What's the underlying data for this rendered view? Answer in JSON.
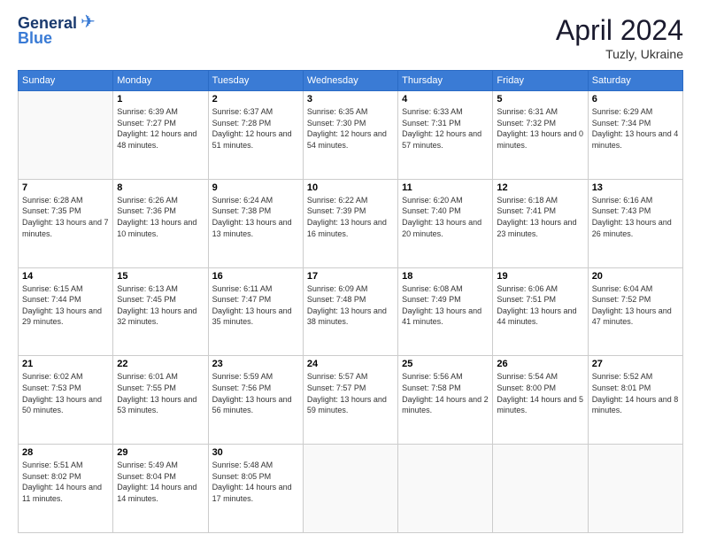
{
  "header": {
    "logo_line1": "General",
    "logo_line2": "Blue",
    "month_title": "April 2024",
    "location": "Tuzly, Ukraine"
  },
  "days_of_week": [
    "Sunday",
    "Monday",
    "Tuesday",
    "Wednesday",
    "Thursday",
    "Friday",
    "Saturday"
  ],
  "weeks": [
    [
      {
        "day": "",
        "sunrise": "",
        "sunset": "",
        "daylight": ""
      },
      {
        "day": "1",
        "sunrise": "Sunrise: 6:39 AM",
        "sunset": "Sunset: 7:27 PM",
        "daylight": "Daylight: 12 hours and 48 minutes."
      },
      {
        "day": "2",
        "sunrise": "Sunrise: 6:37 AM",
        "sunset": "Sunset: 7:28 PM",
        "daylight": "Daylight: 12 hours and 51 minutes."
      },
      {
        "day": "3",
        "sunrise": "Sunrise: 6:35 AM",
        "sunset": "Sunset: 7:30 PM",
        "daylight": "Daylight: 12 hours and 54 minutes."
      },
      {
        "day": "4",
        "sunrise": "Sunrise: 6:33 AM",
        "sunset": "Sunset: 7:31 PM",
        "daylight": "Daylight: 12 hours and 57 minutes."
      },
      {
        "day": "5",
        "sunrise": "Sunrise: 6:31 AM",
        "sunset": "Sunset: 7:32 PM",
        "daylight": "Daylight: 13 hours and 0 minutes."
      },
      {
        "day": "6",
        "sunrise": "Sunrise: 6:29 AM",
        "sunset": "Sunset: 7:34 PM",
        "daylight": "Daylight: 13 hours and 4 minutes."
      }
    ],
    [
      {
        "day": "7",
        "sunrise": "Sunrise: 6:28 AM",
        "sunset": "Sunset: 7:35 PM",
        "daylight": "Daylight: 13 hours and 7 minutes."
      },
      {
        "day": "8",
        "sunrise": "Sunrise: 6:26 AM",
        "sunset": "Sunset: 7:36 PM",
        "daylight": "Daylight: 13 hours and 10 minutes."
      },
      {
        "day": "9",
        "sunrise": "Sunrise: 6:24 AM",
        "sunset": "Sunset: 7:38 PM",
        "daylight": "Daylight: 13 hours and 13 minutes."
      },
      {
        "day": "10",
        "sunrise": "Sunrise: 6:22 AM",
        "sunset": "Sunset: 7:39 PM",
        "daylight": "Daylight: 13 hours and 16 minutes."
      },
      {
        "day": "11",
        "sunrise": "Sunrise: 6:20 AM",
        "sunset": "Sunset: 7:40 PM",
        "daylight": "Daylight: 13 hours and 20 minutes."
      },
      {
        "day": "12",
        "sunrise": "Sunrise: 6:18 AM",
        "sunset": "Sunset: 7:41 PM",
        "daylight": "Daylight: 13 hours and 23 minutes."
      },
      {
        "day": "13",
        "sunrise": "Sunrise: 6:16 AM",
        "sunset": "Sunset: 7:43 PM",
        "daylight": "Daylight: 13 hours and 26 minutes."
      }
    ],
    [
      {
        "day": "14",
        "sunrise": "Sunrise: 6:15 AM",
        "sunset": "Sunset: 7:44 PM",
        "daylight": "Daylight: 13 hours and 29 minutes."
      },
      {
        "day": "15",
        "sunrise": "Sunrise: 6:13 AM",
        "sunset": "Sunset: 7:45 PM",
        "daylight": "Daylight: 13 hours and 32 minutes."
      },
      {
        "day": "16",
        "sunrise": "Sunrise: 6:11 AM",
        "sunset": "Sunset: 7:47 PM",
        "daylight": "Daylight: 13 hours and 35 minutes."
      },
      {
        "day": "17",
        "sunrise": "Sunrise: 6:09 AM",
        "sunset": "Sunset: 7:48 PM",
        "daylight": "Daylight: 13 hours and 38 minutes."
      },
      {
        "day": "18",
        "sunrise": "Sunrise: 6:08 AM",
        "sunset": "Sunset: 7:49 PM",
        "daylight": "Daylight: 13 hours and 41 minutes."
      },
      {
        "day": "19",
        "sunrise": "Sunrise: 6:06 AM",
        "sunset": "Sunset: 7:51 PM",
        "daylight": "Daylight: 13 hours and 44 minutes."
      },
      {
        "day": "20",
        "sunrise": "Sunrise: 6:04 AM",
        "sunset": "Sunset: 7:52 PM",
        "daylight": "Daylight: 13 hours and 47 minutes."
      }
    ],
    [
      {
        "day": "21",
        "sunrise": "Sunrise: 6:02 AM",
        "sunset": "Sunset: 7:53 PM",
        "daylight": "Daylight: 13 hours and 50 minutes."
      },
      {
        "day": "22",
        "sunrise": "Sunrise: 6:01 AM",
        "sunset": "Sunset: 7:55 PM",
        "daylight": "Daylight: 13 hours and 53 minutes."
      },
      {
        "day": "23",
        "sunrise": "Sunrise: 5:59 AM",
        "sunset": "Sunset: 7:56 PM",
        "daylight": "Daylight: 13 hours and 56 minutes."
      },
      {
        "day": "24",
        "sunrise": "Sunrise: 5:57 AM",
        "sunset": "Sunset: 7:57 PM",
        "daylight": "Daylight: 13 hours and 59 minutes."
      },
      {
        "day": "25",
        "sunrise": "Sunrise: 5:56 AM",
        "sunset": "Sunset: 7:58 PM",
        "daylight": "Daylight: 14 hours and 2 minutes."
      },
      {
        "day": "26",
        "sunrise": "Sunrise: 5:54 AM",
        "sunset": "Sunset: 8:00 PM",
        "daylight": "Daylight: 14 hours and 5 minutes."
      },
      {
        "day": "27",
        "sunrise": "Sunrise: 5:52 AM",
        "sunset": "Sunset: 8:01 PM",
        "daylight": "Daylight: 14 hours and 8 minutes."
      }
    ],
    [
      {
        "day": "28",
        "sunrise": "Sunrise: 5:51 AM",
        "sunset": "Sunset: 8:02 PM",
        "daylight": "Daylight: 14 hours and 11 minutes."
      },
      {
        "day": "29",
        "sunrise": "Sunrise: 5:49 AM",
        "sunset": "Sunset: 8:04 PM",
        "daylight": "Daylight: 14 hours and 14 minutes."
      },
      {
        "day": "30",
        "sunrise": "Sunrise: 5:48 AM",
        "sunset": "Sunset: 8:05 PM",
        "daylight": "Daylight: 14 hours and 17 minutes."
      },
      {
        "day": "",
        "sunrise": "",
        "sunset": "",
        "daylight": ""
      },
      {
        "day": "",
        "sunrise": "",
        "sunset": "",
        "daylight": ""
      },
      {
        "day": "",
        "sunrise": "",
        "sunset": "",
        "daylight": ""
      },
      {
        "day": "",
        "sunrise": "",
        "sunset": "",
        "daylight": ""
      }
    ]
  ]
}
